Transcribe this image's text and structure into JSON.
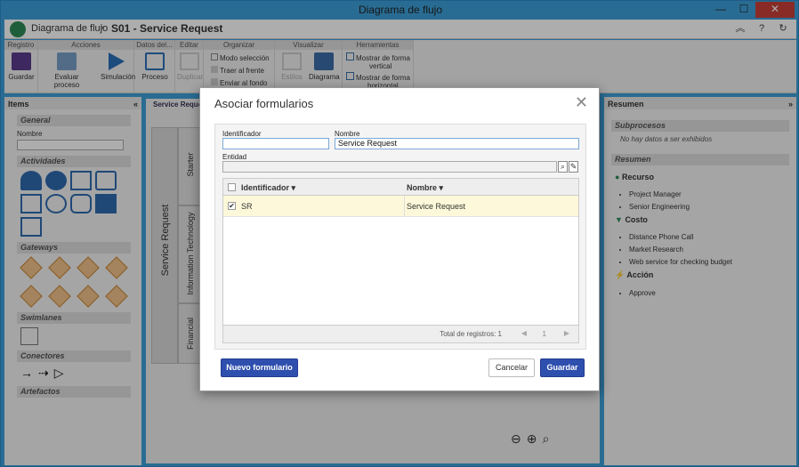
{
  "window": {
    "title": "Diagrama de flujo"
  },
  "header": {
    "breadcrumb": "Diagrama de flujo",
    "title": "S01 - Service Request"
  },
  "ribbon": {
    "groups": [
      "Registro",
      "Acciones",
      "Datos del...",
      "Editar",
      "Organizar",
      "Visualizar",
      "Herramientas"
    ],
    "save": "Guardar",
    "evaluate": "Evaluar proceso",
    "simulate": "Simulación",
    "process": "Proceso",
    "duplicate": "Duplicar",
    "select_mode": "Modo selección",
    "bring_front": "Traer al frente",
    "send_back": "Enviar al fondo",
    "styles": "Estilos",
    "diagram": "Diagrama",
    "show_vertical_1": "Mostrar de forma",
    "show_vertical_2": "vertical",
    "show_horizontal_1": "Mostrar de forma",
    "show_horizontal_2": "horizontal"
  },
  "left": {
    "title": "Items",
    "general": "General",
    "name_label": "Nombre",
    "activities": "Actividades",
    "gateways": "Gateways",
    "swimlanes": "Swimlanes",
    "connectors": "Conectores",
    "artifacts": "Artefactos"
  },
  "canvas": {
    "tab": "Service Request",
    "pool": "Service Request",
    "lanes": [
      "Starter",
      "Information Technology",
      "Financial"
    ]
  },
  "right": {
    "title": "Resumen",
    "subprocesses": "Subprocesos",
    "no_data": "No hay datos a ser exhibidos",
    "summary": "Resumen",
    "resource": "Recurso",
    "resource_items": [
      "Project Manager",
      "Senior Engineering"
    ],
    "cost": "Costo",
    "cost_items": [
      "Distance Phone Call",
      "Market Research",
      "Web service for checking budget"
    ],
    "action": "Acción",
    "action_items": [
      "Approve"
    ]
  },
  "modal": {
    "title": "Asociar formularios",
    "id_label": "Identificador",
    "id_value": "",
    "name_label": "Nombre",
    "name_value": "Service Request",
    "entity_label": "Entidad",
    "entity_value": "",
    "col_id": "Identificador",
    "col_name": "Nombre",
    "rows": [
      {
        "id": "SR",
        "name": "Service Request",
        "checked": true
      }
    ],
    "total": "Total de registros: 1",
    "page": "1",
    "new_form": "Nuevo formulario",
    "cancel": "Cancelar",
    "save": "Guardar"
  },
  "colors": {
    "accent": "#2e4fae",
    "titlebar": "#3d9fd9",
    "close": "#c9403a",
    "selected_row": "#fcf8d9"
  }
}
